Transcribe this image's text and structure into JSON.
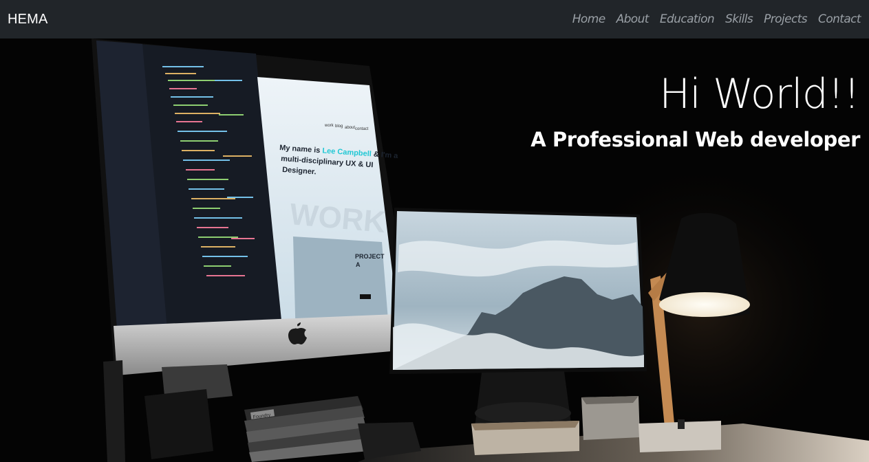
{
  "navbar": {
    "brand": "HEMA",
    "links": [
      "Home",
      "About",
      "Education",
      "Skills",
      "Projects",
      "Contact"
    ]
  },
  "hero": {
    "headline": "Hi World!!",
    "subline": "A Professional Web developer",
    "screen_text": {
      "nav_items": [
        "work",
        "blog",
        "about",
        "contact"
      ],
      "intro_prefix": "My name is ",
      "intro_name": "Lee Campbell",
      "intro_suffix": " & I'm a",
      "intro_line2": "multi-disciplinary UX & UI",
      "intro_line3": "Designer.",
      "watermark": "WORK",
      "project_title_1": "PROJECT",
      "project_title_2": "A",
      "book_label": "Foundry"
    }
  },
  "colors": {
    "navbar_bg": "#212529",
    "nav_link": "#9aa0a6",
    "accent_cyan": "#1fc7d4"
  }
}
